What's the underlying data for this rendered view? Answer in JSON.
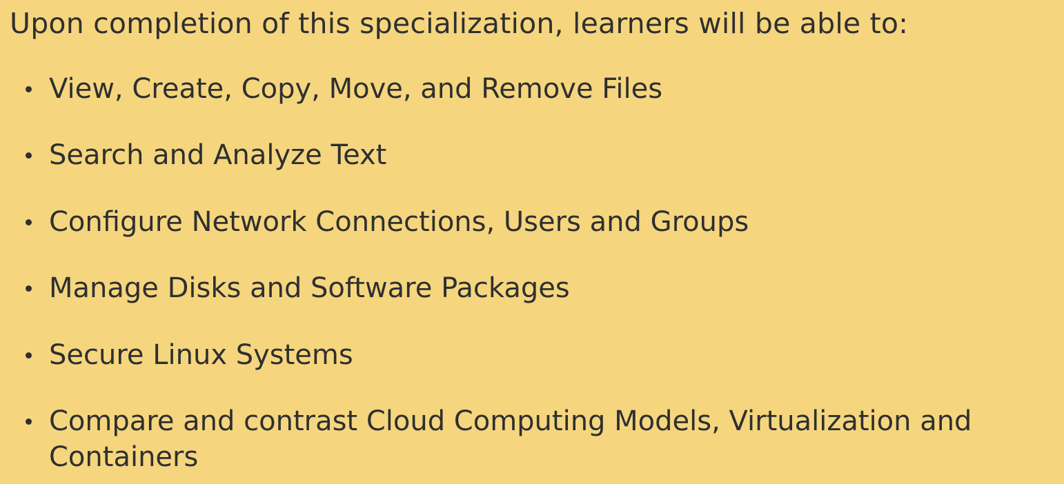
{
  "slide": {
    "intro": "Upon completion of this specialization, learners will be able to:",
    "bullets": [
      "View, Create, Copy, Move, and Remove Files",
      "Search and Analyze Text",
      "Configure Network Connections, Users and Groups",
      "Manage Disks and Software Packages",
      "Secure Linux Systems",
      "Compare and contrast Cloud Computing Models, Virtualization and Containers"
    ]
  },
  "colors": {
    "background": "#f5d67e",
    "text": "#2f2f2f"
  }
}
